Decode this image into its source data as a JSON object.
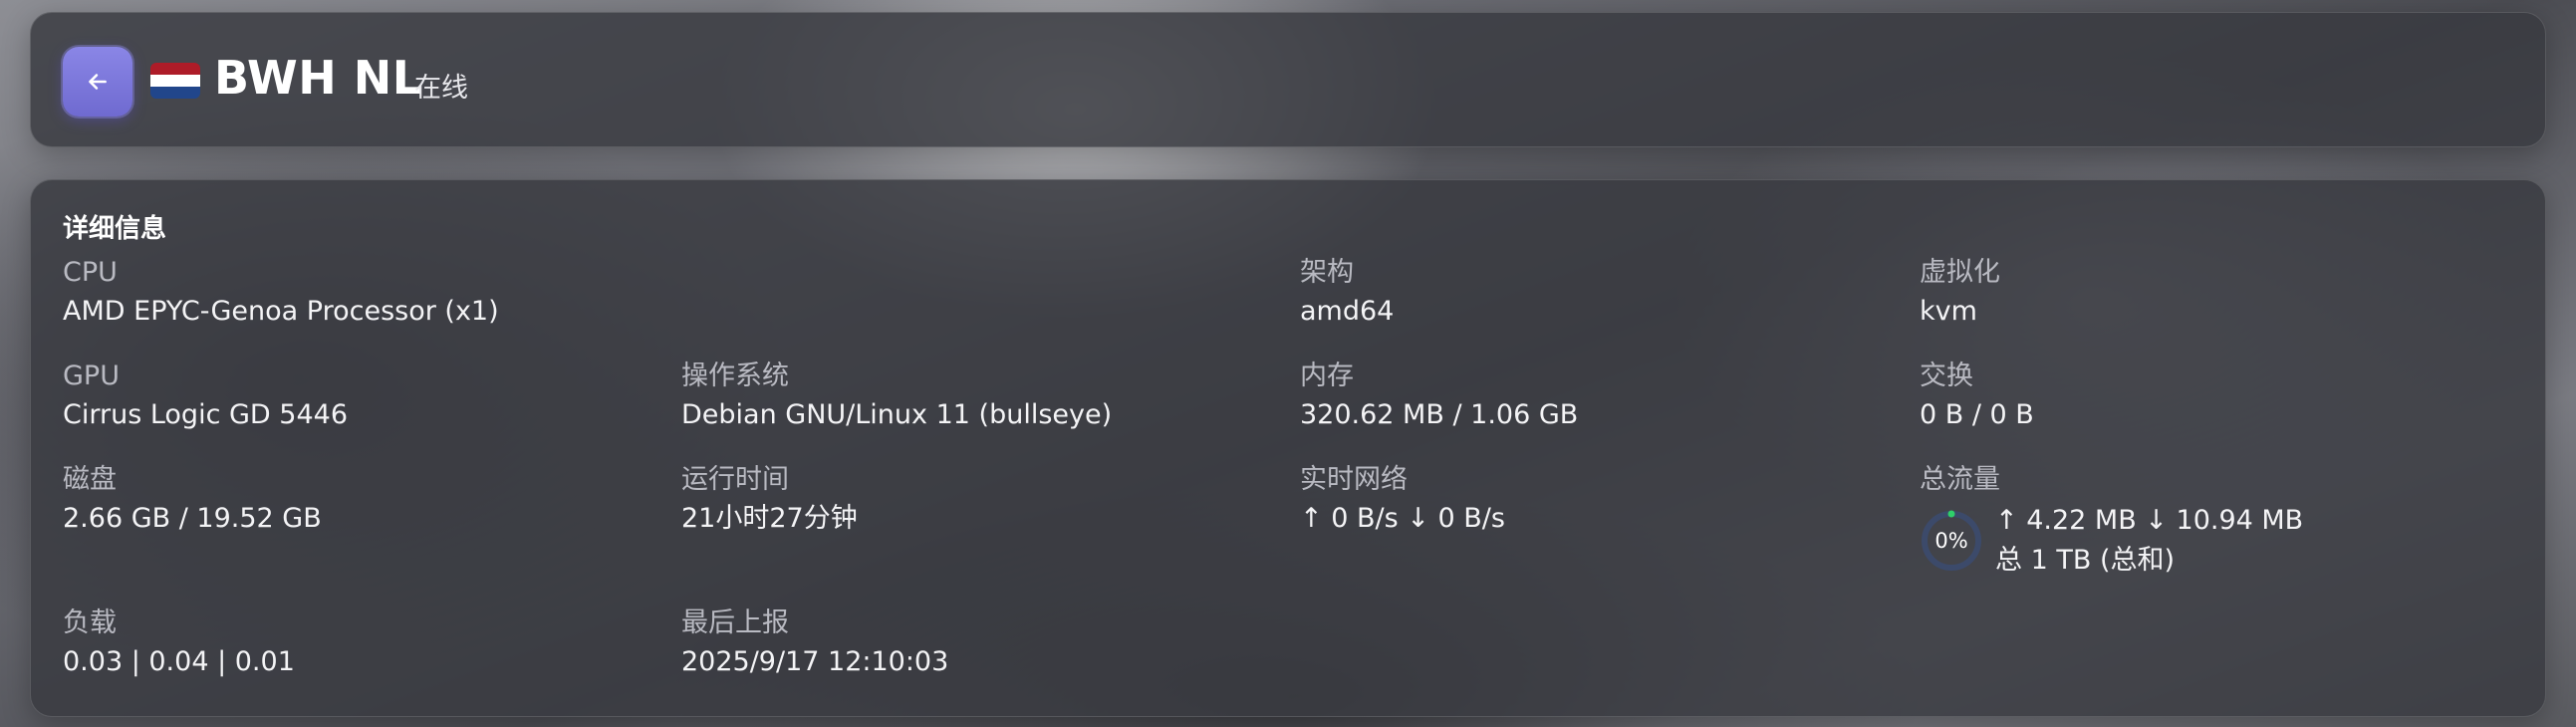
{
  "header": {
    "back_icon": "arrow-left-icon",
    "flag_icon": "netherlands-flag-icon",
    "flag_colors": [
      "#ae1c28",
      "#ffffff",
      "#21468b"
    ],
    "server_name": "BWH NL",
    "status": "在线",
    "accent_color": "#7c77dd"
  },
  "details": {
    "title": "详细信息",
    "cpu": {
      "label": "CPU",
      "value": "AMD EPYC-Genoa Processor (x1)"
    },
    "arch": {
      "label": "架构",
      "value": "amd64"
    },
    "virtualization": {
      "label": "虚拟化",
      "value": "kvm"
    },
    "gpu": {
      "label": "GPU",
      "value": "Cirrus Logic GD 5446"
    },
    "os": {
      "label": "操作系统",
      "value": "Debian GNU/Linux 11 (bullseye)"
    },
    "memory": {
      "label": "内存",
      "value": "320.62 MB / 1.06 GB"
    },
    "swap": {
      "label": "交换",
      "value": "0 B / 0 B"
    },
    "disk": {
      "label": "磁盘",
      "value": "2.66 GB / 19.52 GB"
    },
    "uptime": {
      "label": "运行时间",
      "value": "21小时27分钟"
    },
    "network": {
      "label": "实时网络",
      "value": "↑ 0 B/s ↓ 0 B/s"
    },
    "traffic": {
      "label": "总流量",
      "percent_text": "0%",
      "percent": 0,
      "updown": "↑ 4.22 MB ↓ 10.94 MB",
      "total": "总 1 TB (总和)",
      "ring_color": "#2fcf6a",
      "track_color": "#3c4a6a"
    },
    "load": {
      "label": "负载",
      "value": "0.03 | 0.04 | 0.01"
    },
    "last_report": {
      "label": "最后上报",
      "value": "2025/9/17 12:10:03"
    }
  }
}
